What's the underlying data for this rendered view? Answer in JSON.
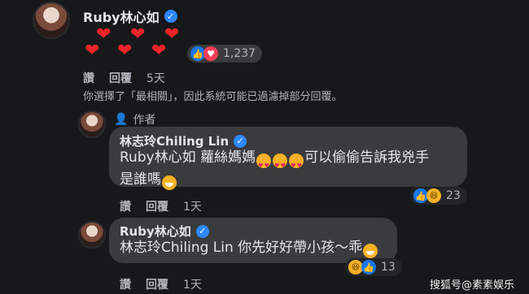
{
  "comment1": {
    "author": "Ruby林心如",
    "hearts": [
      "❤",
      "❤",
      "❤",
      "❤",
      "❤",
      "❤"
    ],
    "reaction_count": "1,237",
    "actions": {
      "like": "讚",
      "reply": "回覆",
      "time": "5天"
    },
    "filter_note": "你選擇了「最相關」，因此系統可能已過濾掉部分回覆。"
  },
  "reply1": {
    "author_badge": "作者",
    "author": "林志玲Chiling Lin",
    "text_line1_a": "Ruby林心如 蘿絲媽媽",
    "text_line1_b": "可以偷偷告訴我兇手",
    "text_line2": "是誰嗎",
    "reaction_count": "23",
    "actions": {
      "like": "讚",
      "reply": "回覆",
      "time": "1天"
    }
  },
  "reply2": {
    "author": "Ruby林心如",
    "text": "林志玲Chiling Lin 你先好好帶小孩～乖",
    "reaction_count": "13",
    "actions": {
      "like": "讚",
      "reply": "回覆",
      "time": "1天"
    }
  },
  "watermark": "搜狐号@素素娱乐",
  "colors": {
    "background": "#17181a",
    "bubble": "#3a3b3c",
    "verified": "#2d88ff",
    "heart": "#f0242a"
  },
  "icons": {
    "verified": "check-badge",
    "like": "thumbs-up",
    "love": "heart",
    "haha": "laughing-face"
  }
}
